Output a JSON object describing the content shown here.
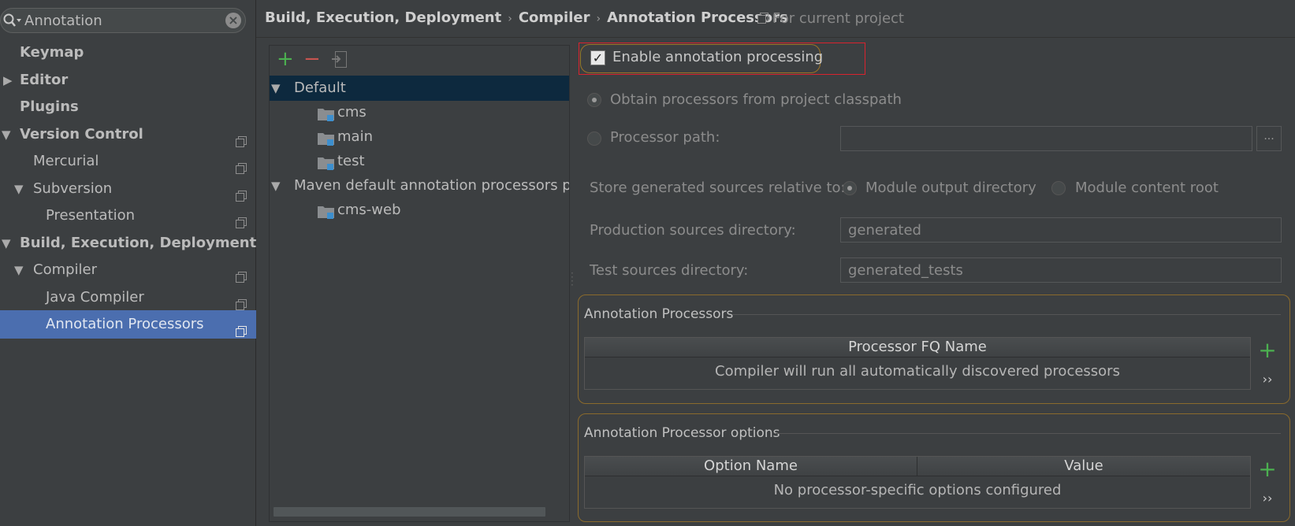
{
  "search": {
    "value": "Annotation"
  },
  "sidebar": {
    "items": [
      {
        "label": "Keymap"
      },
      {
        "label": "Editor"
      },
      {
        "label": "Plugins"
      },
      {
        "label": "Version Control"
      },
      {
        "label": "Mercurial"
      },
      {
        "label": "Subversion"
      },
      {
        "label": "Presentation"
      },
      {
        "label": "Build, Execution, Deployment"
      },
      {
        "label": "Compiler"
      },
      {
        "label": "Java Compiler"
      },
      {
        "label": "Annotation Processors"
      }
    ]
  },
  "header": {
    "breadcrumb": [
      "Build, Execution, Deployment",
      "Compiler",
      "Annotation Processors"
    ],
    "scope": "For current project"
  },
  "tree": {
    "toolbar": {
      "add": "+",
      "remove": "−"
    },
    "rows": [
      {
        "label": "Default"
      },
      {
        "label": "cms"
      },
      {
        "label": "main"
      },
      {
        "label": "test"
      },
      {
        "label": "Maven default annotation processors profile"
      },
      {
        "label": "cms-web"
      }
    ]
  },
  "settings": {
    "enable_label": "Enable annotation processing",
    "enable_checked": true,
    "obtain_label": "Obtain processors from project classpath",
    "processor_path_label": "Processor path:",
    "processor_path_value": "",
    "browse_label": "...",
    "store_label": "Store generated sources relative to:",
    "module_output_label": "Module output directory",
    "module_content_label": "Module content root",
    "production_label": "Production sources directory:",
    "production_value": "generated",
    "test_label": "Test sources directory:",
    "test_value": "generated_tests"
  },
  "processors_group": {
    "title": "Annotation Processors",
    "column": "Processor FQ Name",
    "empty": "Compiler will run all automatically discovered processors"
  },
  "options_group": {
    "title": "Annotation Processor options",
    "columns": [
      "Option Name",
      "Value"
    ],
    "empty": "No processor-specific options configured"
  },
  "colors": {
    "background": "#3c3f41",
    "selection": "#4b6eaf",
    "tree_selection": "#0d293e",
    "add_green": "#4cb050",
    "remove_red": "#c75450",
    "highlight_red": "#d9232e"
  }
}
